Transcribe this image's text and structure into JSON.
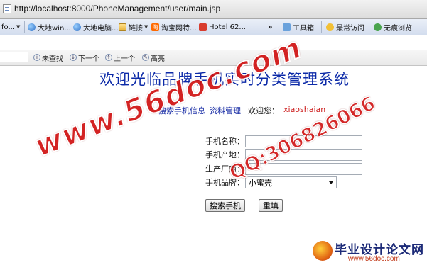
{
  "browser": {
    "url": "http://localhost:8000/PhoneManagement/user/main.jsp",
    "bookmarks": [
      {
        "label": "fo...",
        "icon": "globe-icon"
      },
      {
        "label": "大地win...",
        "icon": "globe-icon"
      },
      {
        "label": "大地电脑...",
        "icon": "globe-icon"
      },
      {
        "label": "链接",
        "icon": "folder-icon"
      },
      {
        "label": "淘宝网特...",
        "icon": "taobao-icon"
      },
      {
        "label": "Hotel 62...",
        "icon": "hotel-icon"
      },
      {
        "label": "工具箱",
        "icon": "toolbox-icon"
      },
      {
        "label": "最常访问",
        "icon": "star-icon"
      },
      {
        "label": "无痕浏览",
        "icon": "gear-icon"
      }
    ],
    "overflow_label": "»",
    "find_bar": {
      "not_found": "未查找",
      "next": "下一个",
      "previous": "上一个",
      "highlight": "高亮"
    }
  },
  "page": {
    "title": "欢迎光临品牌手机实时分类管理系统",
    "nav": {
      "search_link": "搜索手机信息",
      "profile_link": "资料管理",
      "welcome_text": "欢迎您：",
      "username": "xiaoshaian"
    },
    "form": {
      "name_label": "手机名称：",
      "name_value": "",
      "origin_label": "手机产地：",
      "origin_value": "",
      "manufacturer_label": "生产厂商：",
      "manufacturer_value": "",
      "brand_label": "手机品牌：",
      "brand_selected": "小蜜壳",
      "search_button": "搜索手机",
      "reset_button": "重填"
    }
  },
  "watermarks": {
    "main": "www.56doc.com",
    "qq": "QQ:306826066",
    "logo_text": "毕业设计论文网",
    "logo_url": "www.56doc.com"
  }
}
